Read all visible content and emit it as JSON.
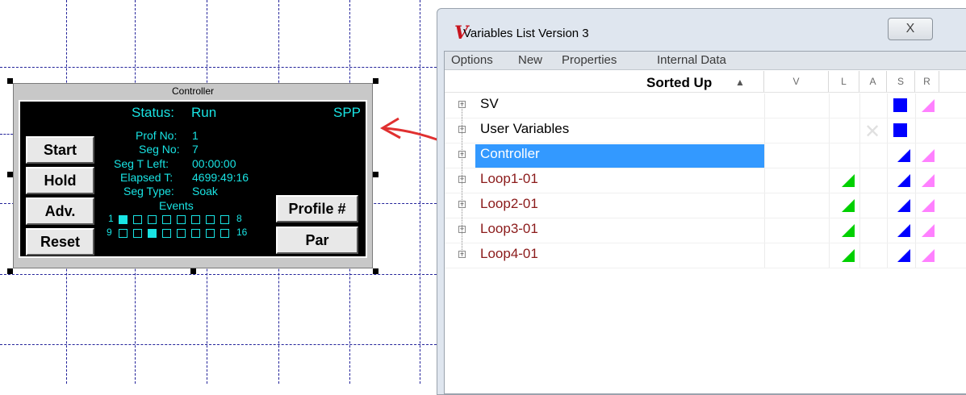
{
  "controller": {
    "title": "Controller",
    "status_label": "Status:",
    "status_value": "Run",
    "mode": "SPP",
    "fields": [
      {
        "label": "Prof No:",
        "value": "1"
      },
      {
        "label": "Seg No:",
        "value": "7"
      },
      {
        "label": "Seg T Left:",
        "value": "00:00:00"
      },
      {
        "label": "Elapsed T:",
        "value": "4699:49:16"
      },
      {
        "label": "Seg Type:",
        "value": "Soak"
      }
    ],
    "events_label": "Events",
    "events_row1_start": "1",
    "events_row1_end": "8",
    "events_row2_start": "9",
    "events_row2_end": "16",
    "events_on": [
      1,
      11
    ],
    "buttons": {
      "start": "Start",
      "hold": "Hold",
      "adv": "Adv.",
      "reset": "Reset",
      "profile": "Profile #",
      "par": "Par"
    }
  },
  "window": {
    "logo": "V",
    "title": "Variables List Version 3",
    "close_glyph": "X",
    "menu": [
      "Options",
      "New",
      "Properties",
      "Internal Data"
    ],
    "sort_label": "Sorted Up",
    "sort_arrow": "▲",
    "columns": {
      "v": "V",
      "l": "L",
      "a": "A",
      "s": "S",
      "r": "R"
    },
    "rows": [
      {
        "label": "SV",
        "style": "normal",
        "l": "",
        "a": "",
        "s": "blue-square",
        "r": "pink-tri"
      },
      {
        "label": "User Variables",
        "style": "normal",
        "l": "",
        "a": "x",
        "s": "blue-square",
        "r": ""
      },
      {
        "label": "Controller",
        "style": "selected",
        "l": "",
        "a": "",
        "s": "blue-tri",
        "r": "pink-tri"
      },
      {
        "label": "Loop1-01",
        "style": "red",
        "l": "green-tri",
        "a": "",
        "s": "blue-tri",
        "r": "pink-tri"
      },
      {
        "label": "Loop2-01",
        "style": "red",
        "l": "green-tri",
        "a": "",
        "s": "blue-tri",
        "r": "pink-tri"
      },
      {
        "label": "Loop3-01",
        "style": "red",
        "l": "green-tri",
        "a": "",
        "s": "blue-tri",
        "r": "pink-tri"
      },
      {
        "label": "Loop4-01",
        "style": "red",
        "l": "green-tri",
        "a": "",
        "s": "blue-tri",
        "r": "pink-tri"
      }
    ],
    "colors": {
      "selected": "#3399ff",
      "blue": "#0000ff",
      "pink": "#ff80ff",
      "green": "#00d000",
      "row_red": "#8b1a1a"
    }
  },
  "arrow_color": "#e03030"
}
